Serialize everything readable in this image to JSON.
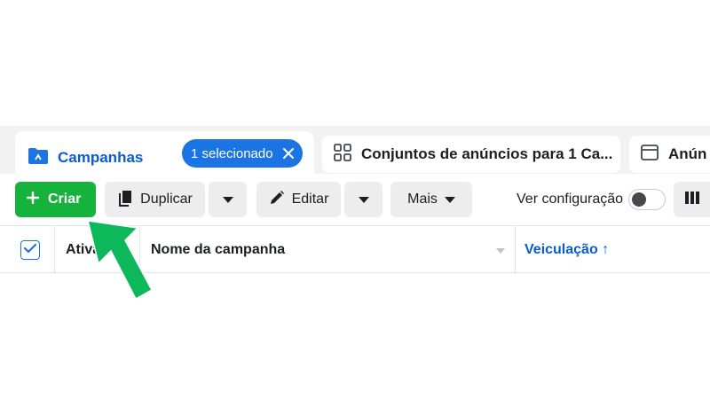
{
  "tabs": {
    "campaigns": {
      "label": "Campanhas",
      "selected_chip": "1 selecionado"
    },
    "adsets": {
      "label": "Conjuntos de anúncios para 1 Ca..."
    },
    "ads": {
      "label": "Anún"
    }
  },
  "toolbar": {
    "create_label": "Criar",
    "duplicate_label": "Duplicar",
    "edit_label": "Editar",
    "more_label": "Mais",
    "settings_label": "Ver configuração",
    "settings_toggle_on": false
  },
  "table": {
    "columns": [
      "Ativa",
      "Nome da campanha",
      "Veiculação ↑"
    ],
    "header_checkbox_checked": true
  },
  "colors": {
    "accent_blue": "#1b74e4",
    "create_green": "#16b33c",
    "arrow_green": "#0cb85a"
  }
}
